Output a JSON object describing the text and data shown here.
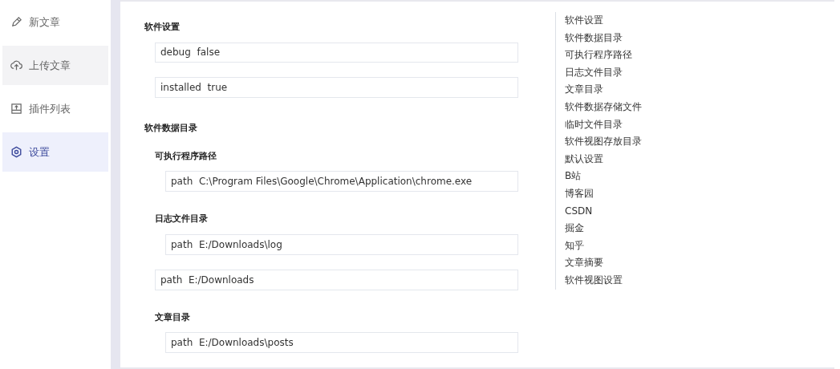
{
  "sidebar": {
    "items": [
      {
        "label": "新文章",
        "selected": false,
        "hovered": false
      },
      {
        "label": "上传文章",
        "selected": false,
        "hovered": true
      },
      {
        "label": "插件列表",
        "selected": false,
        "hovered": false
      },
      {
        "label": "设置",
        "selected": true,
        "hovered": false
      }
    ]
  },
  "settings": [
    {
      "kind": "group",
      "title": "软件设置",
      "children": [
        {
          "kind": "field",
          "value": "debug  false"
        },
        {
          "kind": "field",
          "value": "installed  true"
        }
      ]
    },
    {
      "kind": "group",
      "title": "软件数据目录",
      "children": [
        {
          "kind": "group",
          "title": "可执行程序路径",
          "children": [
            {
              "kind": "field",
              "value": "path  C:\\Program Files\\Google\\Chrome\\Application\\chrome.exe"
            }
          ]
        },
        {
          "kind": "group",
          "title": "日志文件目录",
          "children": [
            {
              "kind": "field",
              "value": "path  E:/Downloads\\log"
            }
          ]
        },
        {
          "kind": "field",
          "value": "path  E:/Downloads"
        },
        {
          "kind": "group",
          "title": "文章目录",
          "children": [
            {
              "kind": "field",
              "value": "path  E:/Downloads\\posts"
            }
          ]
        }
      ]
    }
  ],
  "outline": [
    "软件设置",
    "软件数据目录",
    "可执行程序路径",
    "日志文件目录",
    "文章目录",
    "软件数据存储文件",
    "临时文件目录",
    "软件视图存放目录",
    "默认设置",
    "B站",
    "博客园",
    "CSDN",
    "掘金",
    "知乎",
    "文章摘要",
    "软件视图设置"
  ]
}
